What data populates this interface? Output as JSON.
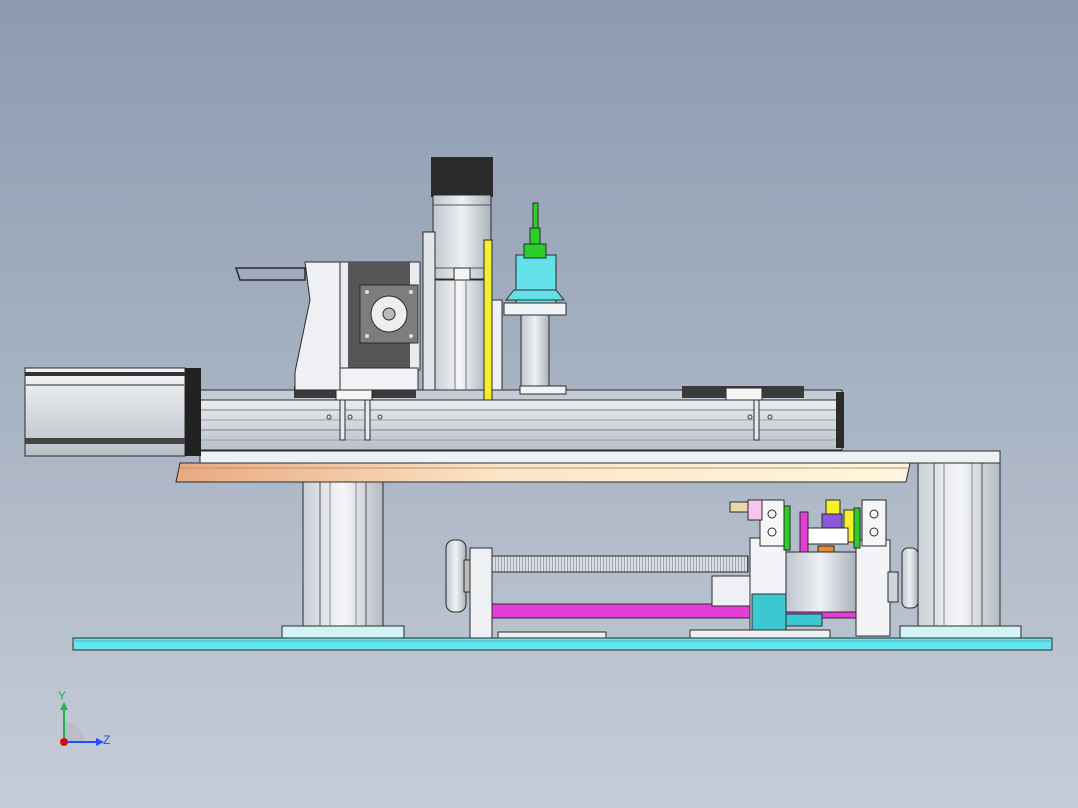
{
  "view": {
    "background_top": "#8d9bb0",
    "background_bottom": "#c6cdd8"
  },
  "triad": {
    "y_label": "Y",
    "z_label": "Z",
    "y_color": "#22b14c",
    "z_color": "#1e50ff",
    "origin_color": "#d01010"
  },
  "colors": {
    "base_plate": "#66e5ef",
    "support_plate": "#f2c7a0",
    "magenta_rod": "#e63cd8",
    "cyan_block": "#3cc8d0",
    "yellow_strip": "#f5ef2c",
    "green_part": "#2ad02a",
    "cyan_cylinder": "#63e0e8",
    "aluminum": "#dfe3e8",
    "dark": "#2b2b2b"
  }
}
